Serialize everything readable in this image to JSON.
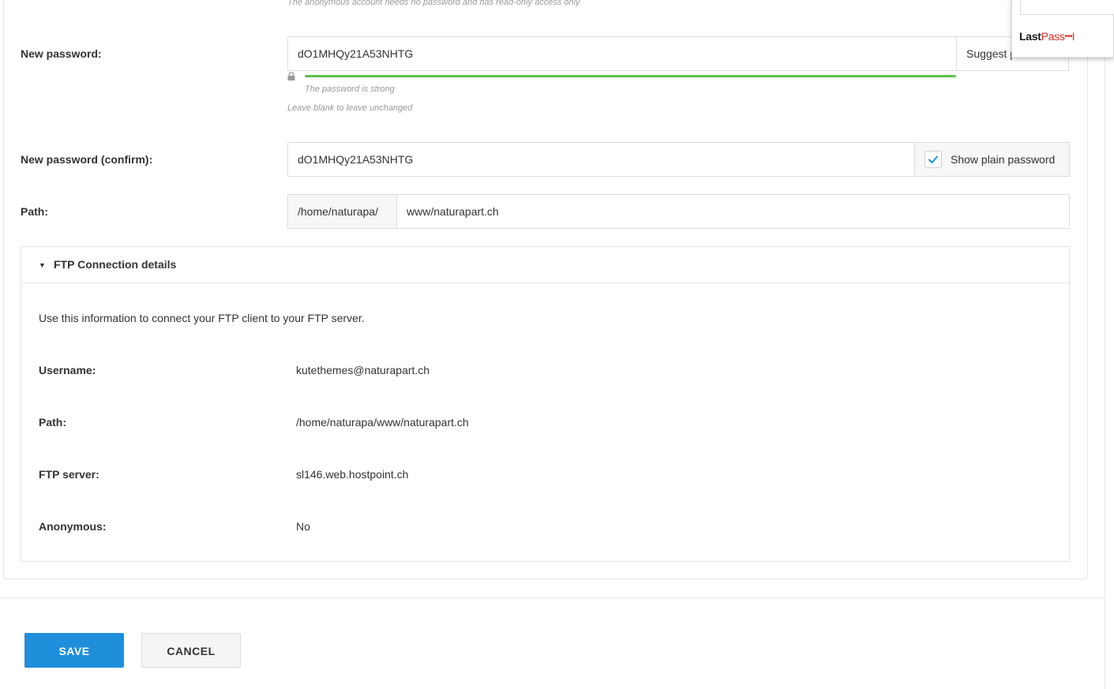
{
  "form": {
    "anonymous_hint": "The anonymous account needs no password and has read-only access only",
    "new_password_label": "New password:",
    "new_password_value": "dO1MHQy21A53NHTG",
    "suggest_label": "Suggest p",
    "strength_fraction": 1.0,
    "strength_text": "The password is strong",
    "leave_blank_hint": "Leave blank to leave unchanged",
    "confirm_label": "New password (confirm):",
    "confirm_value": "dO1MHQy21A53NHTG",
    "show_plain_label": "Show plain password",
    "show_plain_checked": true,
    "path_label": "Path:",
    "path_prefix": "/home/naturapa/",
    "path_value": "www/naturapart.ch"
  },
  "details": {
    "title": "FTP Connection details",
    "intro": "Use this information to connect your FTP client to your FTP server.",
    "rows": [
      {
        "label": "Username:",
        "value": "kutethemes@naturapart.ch"
      },
      {
        "label": "Path:",
        "value": "/home/naturapa/www/naturapart.ch"
      },
      {
        "label": "FTP server:",
        "value": "sl146.web.hostpoint.ch"
      },
      {
        "label": "Anonymous:",
        "value": "No"
      }
    ]
  },
  "actions": {
    "save_label": "SAVE",
    "cancel_label": "CANCEL"
  },
  "lastpass": {
    "logo_last": "Last",
    "logo_pass": "Pass",
    "logo_dots": "•••|"
  },
  "colors": {
    "primary": "#1f8fdb",
    "strength": "#5cc14a",
    "checkmark": "#1f8fdb",
    "lastpass_red": "#d32d27"
  }
}
